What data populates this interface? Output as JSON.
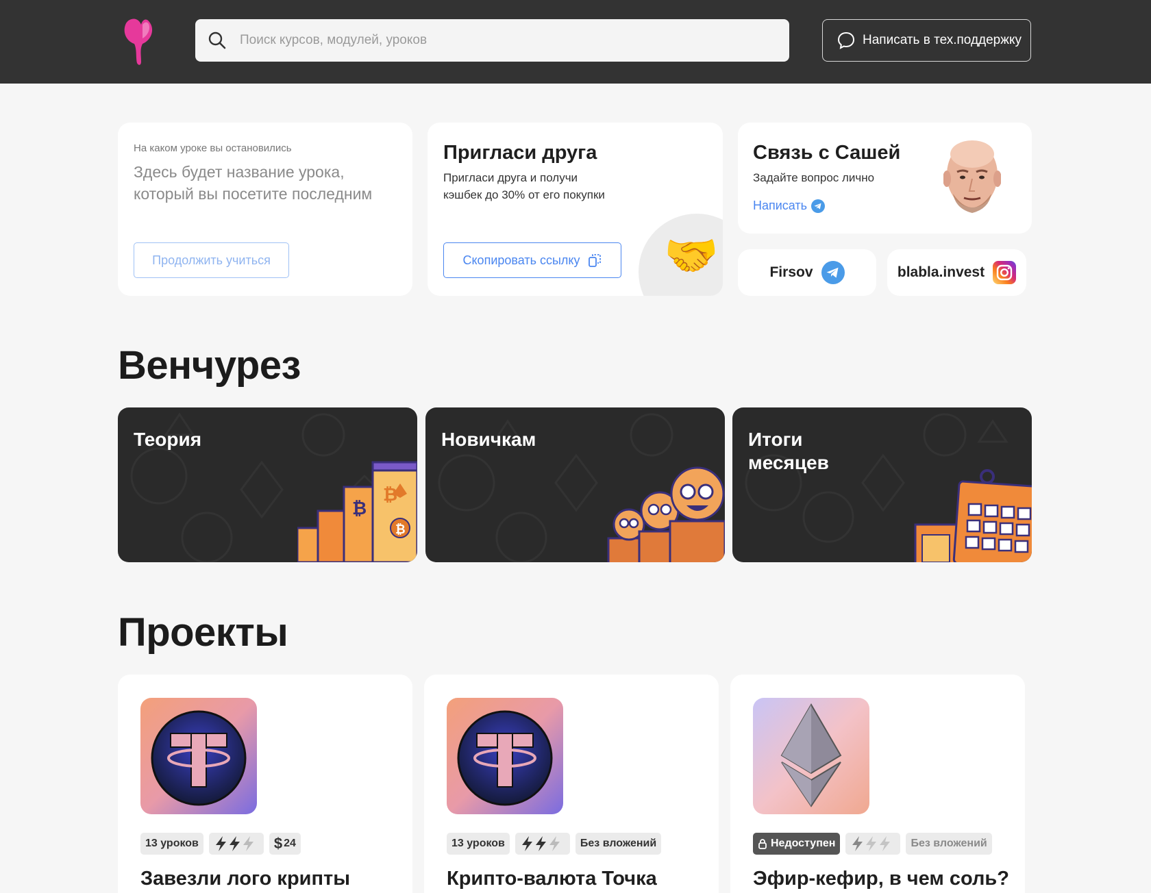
{
  "header": {
    "search_placeholder": "Поиск курсов, модулей, уроков",
    "support_label": "Написать в тех.поддержку"
  },
  "last_lesson": {
    "label": "На каком уроке вы остановились",
    "title": "Здесь будет название урока, который вы посетите последним",
    "button": "Продолжить  учиться"
  },
  "invite": {
    "title": "Пригласи друга",
    "description": "Пригласи друга и получи кэшбек до 30% от его покупки",
    "button": "Скопировать ссылку",
    "emoji": "🤝"
  },
  "contact": {
    "title": "Связь с Сашей",
    "description": "Задайте вопрос лично",
    "link": "Написать"
  },
  "socials": {
    "telegram": "Firsov",
    "instagram": "blabla.invest"
  },
  "venture": {
    "heading": "Венчурез",
    "cards": [
      {
        "title": "Теория"
      },
      {
        "title": "Новичкам"
      },
      {
        "title": "Итоги месяцев"
      }
    ]
  },
  "projects": {
    "heading": "Проекты",
    "items": [
      {
        "title": "Завезли лого крипты",
        "lessons": "13 уроков",
        "difficulty": 2,
        "price": "24",
        "price_symbol": "$"
      },
      {
        "title": "Крипто-валюта Точка",
        "lessons": "13 уроков",
        "difficulty": 2,
        "investment": "Без вложений"
      },
      {
        "title": "Эфир-кефир, в чем соль?",
        "status": "Недоступен",
        "difficulty": 1,
        "investment": "Без вложений"
      }
    ]
  },
  "colors": {
    "header_bg": "#333333",
    "accent": "#4a86f0",
    "brand_pink": "#e6399b"
  }
}
